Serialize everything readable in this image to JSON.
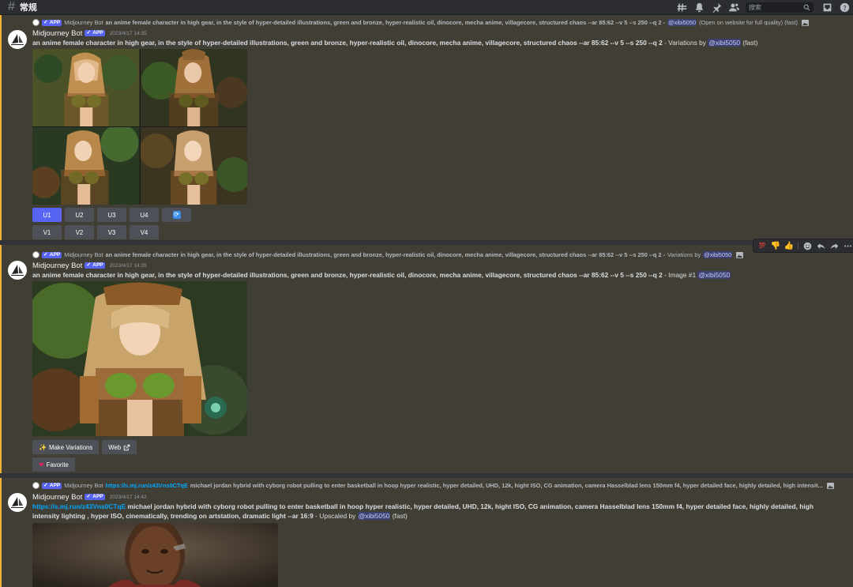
{
  "header": {
    "channel": "常规",
    "search_placeholder": "搜索"
  },
  "colors": {
    "accent": "#5865f2",
    "mention_bar": "#f0b232",
    "link": "#00a8fc"
  },
  "messages": [
    {
      "reply": {
        "app_tag": "APP",
        "name": "Midjourney Bot",
        "text": "an anime female character in high gear, in the style of hyper-detailed illustrations, green and bronze, hyper-realistic oil, dinocore, mecha anime, villagecore, structured chaos --ar 85:62 --v 5 --s 250 --q 2 -",
        "mention": "@xibi5050",
        "after": "(Open on website for full quality) (fast)"
      },
      "author": "Midjourney Bot",
      "app_tag": "APP",
      "timestamp": "2023/4/17 14:35",
      "prompt": "an anime female character in high gear, in the style of hyper-detailed illustrations, green and bronze, hyper-realistic oil, dinocore, mecha anime, villagecore, structured chaos --ar 85:62 --v 5 --s 250 --q 2",
      "suffix": "- Variations by",
      "mention": "@xibi5050",
      "tail": "(fast)",
      "upscale_buttons": [
        "U1",
        "U2",
        "U3",
        "U4"
      ],
      "variation_buttons": [
        "V1",
        "V2",
        "V3",
        "V4"
      ],
      "reroll_icon": "refresh-icon"
    },
    {
      "reply": {
        "app_tag": "APP",
        "name": "Midjourney Bot",
        "text": "an anime female character in high gear, in the style of hyper-detailed illustrations, green and bronze, hyper-realistic oil, dinocore, mecha anime, villagecore, structured chaos --ar 85:62 --v 5 --s 250 --q 2 -",
        "after_label": "Variations by",
        "mention": "@xibi5050"
      },
      "author": "Midjourney Bot",
      "app_tag": "APP",
      "timestamp": "2023/4/17 14:35",
      "prompt": "an anime female character in high gear, in the style of hyper-detailed illustrations, green and bronze, hyper-realistic oil, dinocore, mecha anime, villagecore, structured chaos --ar 85:62 --v 5 --s 250 --q 2",
      "suffix": "- Image #1",
      "mention": "@xibi5050",
      "make_variations": "Make Variations",
      "web": "Web",
      "favorite": "Favorite"
    },
    {
      "reply": {
        "app_tag": "APP",
        "name": "Midjourney Bot",
        "link": "https://s.mj.run/z43Vns0CTqE",
        "text": "michael jordan hybrid with cyborg robot pulling to enter basketball in hoop hyper realistic, hyper detailed, UHD, 12k, hight ISO, CG animation, camera Hasselblad lens 150mm f4, hyper detailed face, highly detailed, high intensit..."
      },
      "author": "Midjourney Bot",
      "app_tag": "APP",
      "timestamp": "2023/4/17 14:42",
      "link": "https://s.mj.run/z43Vns0CTqE",
      "prompt": "michael jordan hybrid with cyborg robot pulling to enter basketball in hoop hyper realistic, hyper detailed, UHD, 12k, hight ISO, CG animation, camera Hasselblad lens 150mm f4, hyper detailed face, highly detailed, high intensity lighting , hyper ISO, cinematically, trending on artstation, dramatic light --ar 16:9",
      "suffix": "- Upscaled by",
      "mention": "@xibi5050",
      "tail": "(fast)"
    }
  ],
  "hover_toolbar": [
    "100-emoji",
    "thumbs-down-emoji",
    "thumbs-up-emoji",
    "add-reaction-icon",
    "reply-icon",
    "forward-icon",
    "more-icon"
  ]
}
